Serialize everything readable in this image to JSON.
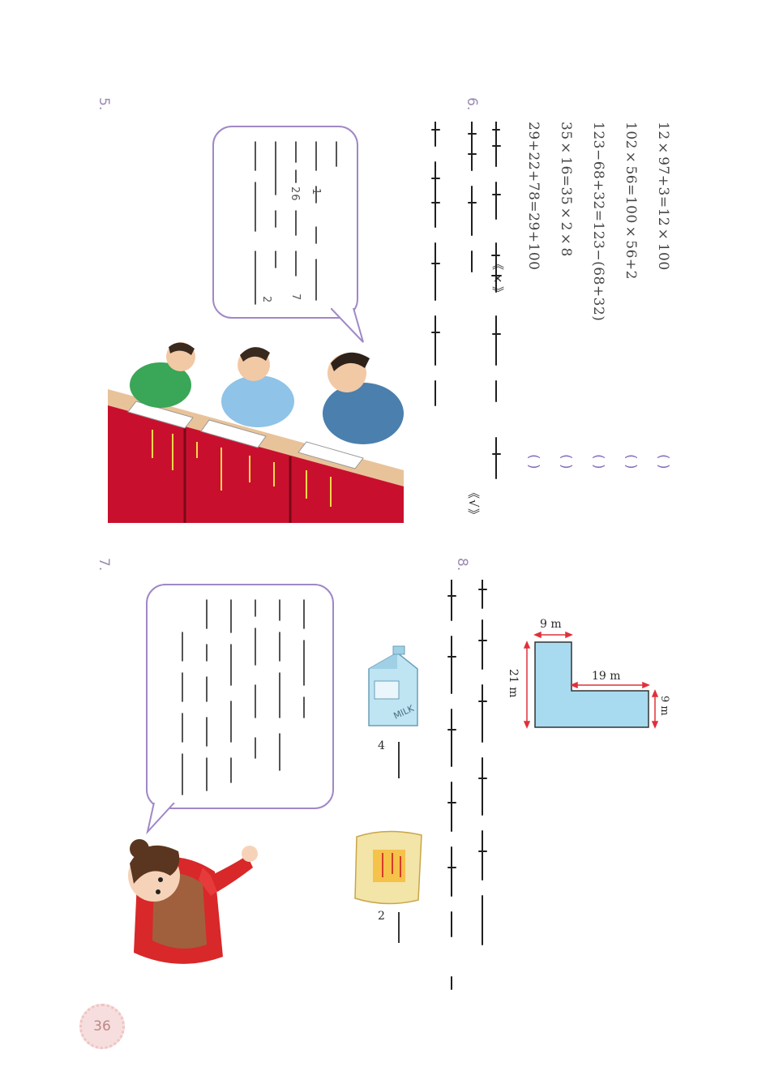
{
  "equations": [
    {
      "text": "12×97+3=12×100",
      "paren": "(     )"
    },
    {
      "text": "102×56=100×56+2",
      "paren": "(     )"
    },
    {
      "text": "123−68+32=123−(68+32)",
      "paren": "(     )"
    },
    {
      "text": "35×16=35×2×8",
      "paren": "(     )"
    },
    {
      "text": "29+22+78=29+100",
      "paren": "(     )"
    }
  ],
  "q6_marks": {
    "wrong": "《×》",
    "right": "《√》"
  },
  "question_numbers": {
    "q5": "5.",
    "q6": "6.",
    "q7": "7.",
    "q8": "8."
  },
  "bubble1_numbers": {
    "n1": "1",
    "n26": "26",
    "n7": "7",
    "n2": "2"
  },
  "shape": {
    "top": "9 m",
    "right": "9 m",
    "inner": "19 m",
    "left": "21 m"
  },
  "products": {
    "milk_label": "MILK",
    "milk_count": "4",
    "bag_count": "2"
  },
  "page_number": "36",
  "colors": {
    "accent": "#a088c6",
    "shape_fill": "#a8dbef",
    "dim": "#e0303a",
    "table": "#c8102e"
  }
}
